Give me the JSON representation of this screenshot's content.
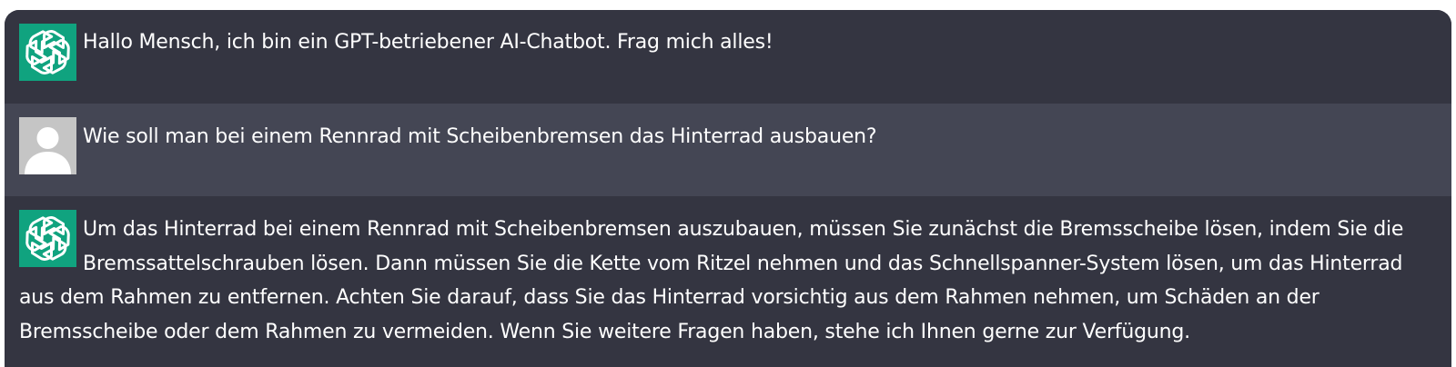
{
  "messages": [
    {
      "role": "assistant",
      "avatar_icon": "openai-logo-icon",
      "avatar_color": "#10a37f",
      "text": "Hallo Mensch, ich bin ein GPT-betriebener AI-Chatbot. Frag mich alles!"
    },
    {
      "role": "user",
      "avatar_icon": "user-silhouette-icon",
      "avatar_color": "#c5c5c5",
      "text": "Wie soll man bei einem Rennrad mit Scheibenbremsen das Hinterrad ausbauen?"
    },
    {
      "role": "assistant",
      "avatar_icon": "openai-logo-icon",
      "avatar_color": "#10a37f",
      "text": "Um das Hinterrad bei einem Rennrad mit Scheibenbremsen auszubauen, müssen Sie zunächst die Bremsscheibe lösen, indem Sie die Bremssattelschrauben lösen. Dann müssen Sie die Kette vom Ritzel nehmen und das Schnellspanner-System lösen, um das Hinterrad aus dem Rahmen zu entfernen. Achten Sie darauf, dass Sie das Hinterrad vorsichtig aus dem Rahmen nehmen, um Schäden an der Bremsscheibe oder dem Rahmen zu vermeiden. Wenn Sie weitere Fragen haben, stehe ich Ihnen gerne zur Verfügung."
    }
  ],
  "colors": {
    "bot_background": "#343541",
    "user_background": "#444654",
    "text": "#ffffff"
  }
}
